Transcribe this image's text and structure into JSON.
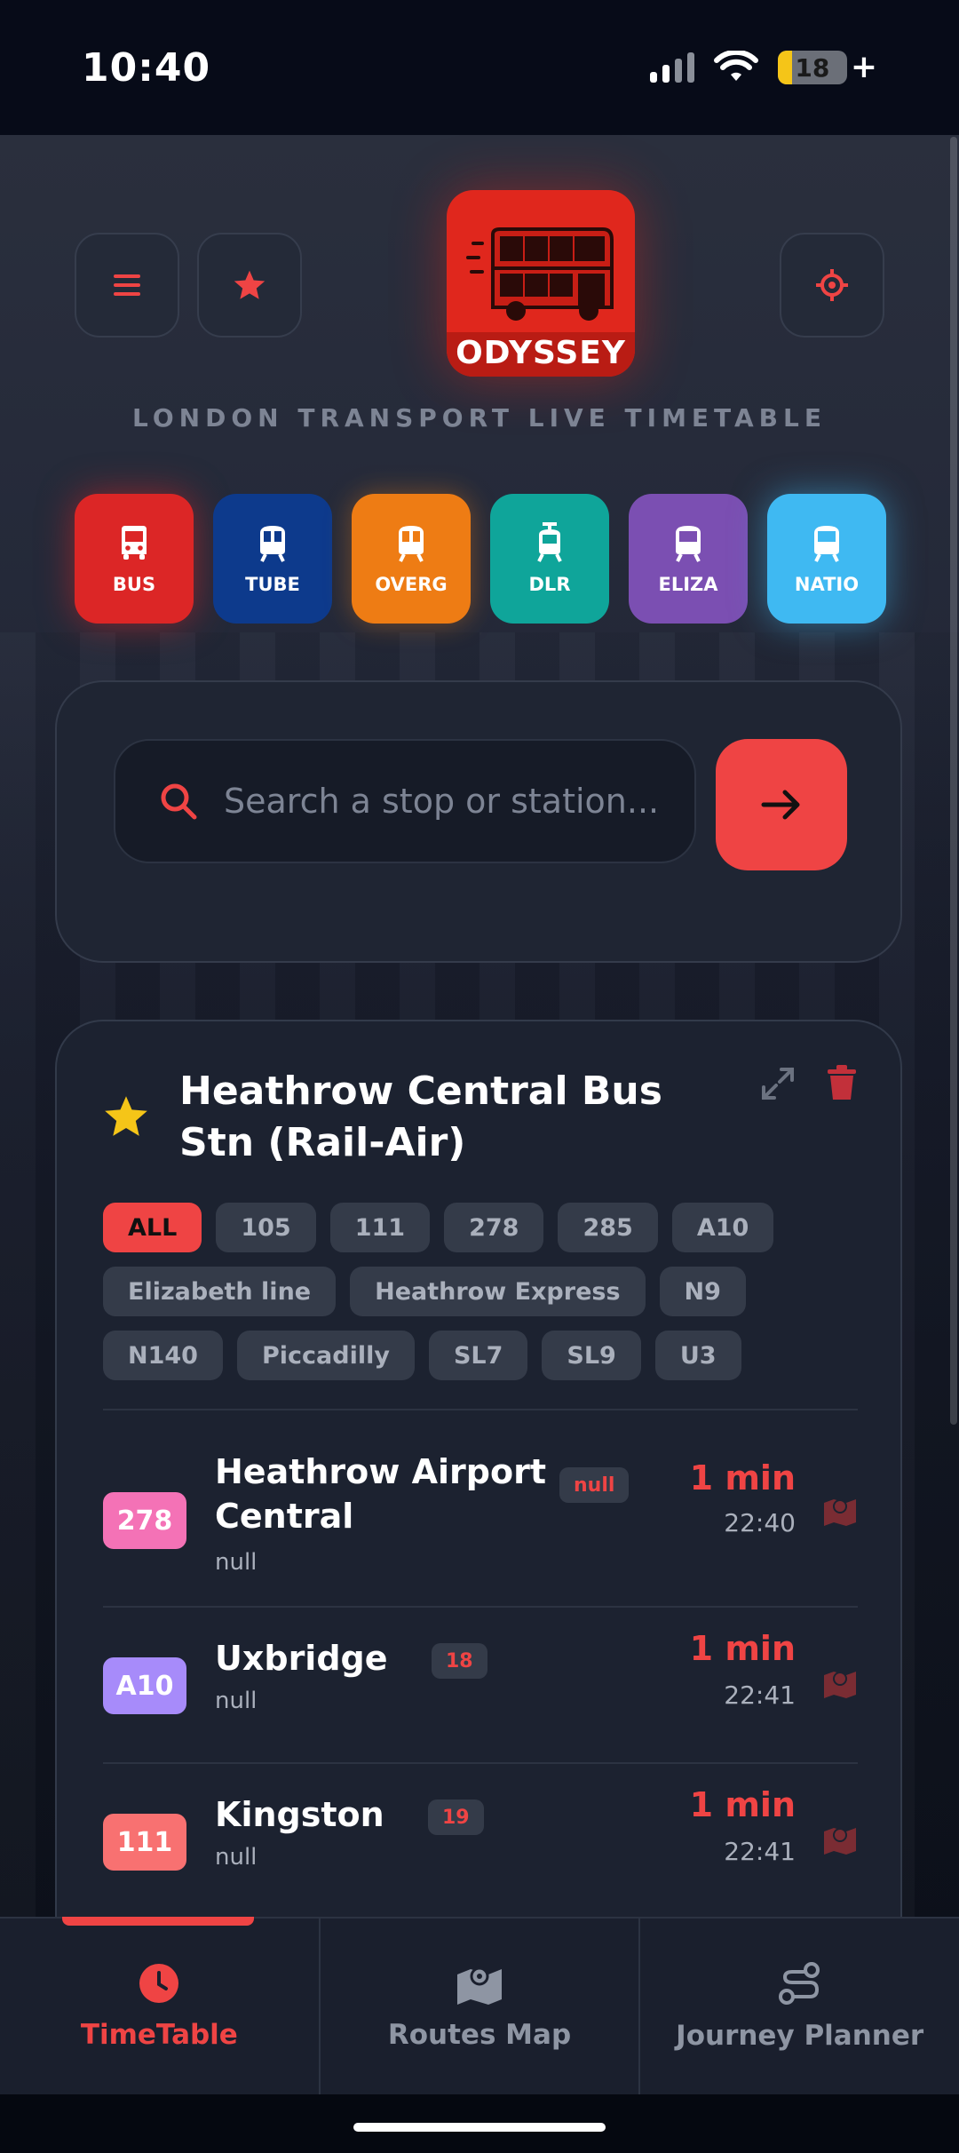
{
  "status_bar": {
    "time": "10:40",
    "battery": "18"
  },
  "header": {
    "logo_text": "ODYSSEY",
    "tagline": "LONDON TRANSPORT LIVE TIMETABLE"
  },
  "modes": [
    {
      "label": "BUS",
      "color": "#dc2626"
    },
    {
      "label": "TUBE",
      "color": "#0d3a8c"
    },
    {
      "label": "OVERG",
      "color": "#ee7c14"
    },
    {
      "label": "DLR",
      "color": "#0fa59a"
    },
    {
      "label": "ELIZA",
      "color": "#7b4fb2"
    },
    {
      "label": "NATIO",
      "color": "#3fb9f2"
    }
  ],
  "search": {
    "placeholder": "Search a stop or station..."
  },
  "stop": {
    "name": "Heathrow Central Bus Stn (Rail-Air)",
    "filters": [
      "ALL",
      "105",
      "111",
      "278",
      "285",
      "A10",
      "Elizabeth line",
      "Heathrow Express",
      "N9",
      "N140",
      "Piccadilly",
      "SL7",
      "SL9",
      "U3"
    ],
    "arrivals": [
      {
        "route": "278",
        "route_color": "#f472b6",
        "destination_line1": "Heathrow Airport",
        "destination_line2": "Central",
        "badge": "null",
        "sub": "null",
        "due": "1 min",
        "time": "22:40"
      },
      {
        "route": "A10",
        "route_color": "#a78bfa",
        "destination_line1": "Uxbridge",
        "destination_line2": "",
        "badge": "18",
        "sub": "null",
        "due": "1 min",
        "time": "22:41"
      },
      {
        "route": "111",
        "route_color": "#f87171",
        "destination_line1": "Kingston",
        "destination_line2": "",
        "badge": "19",
        "sub": "null",
        "due": "1 min",
        "time": "22:41"
      }
    ]
  },
  "nav": {
    "timetable": "TimeTable",
    "routes_map": "Routes Map",
    "journey_planner": "Journey Planner"
  },
  "colors": {
    "accent": "#ef4444",
    "logo_red": "#e0271d"
  }
}
